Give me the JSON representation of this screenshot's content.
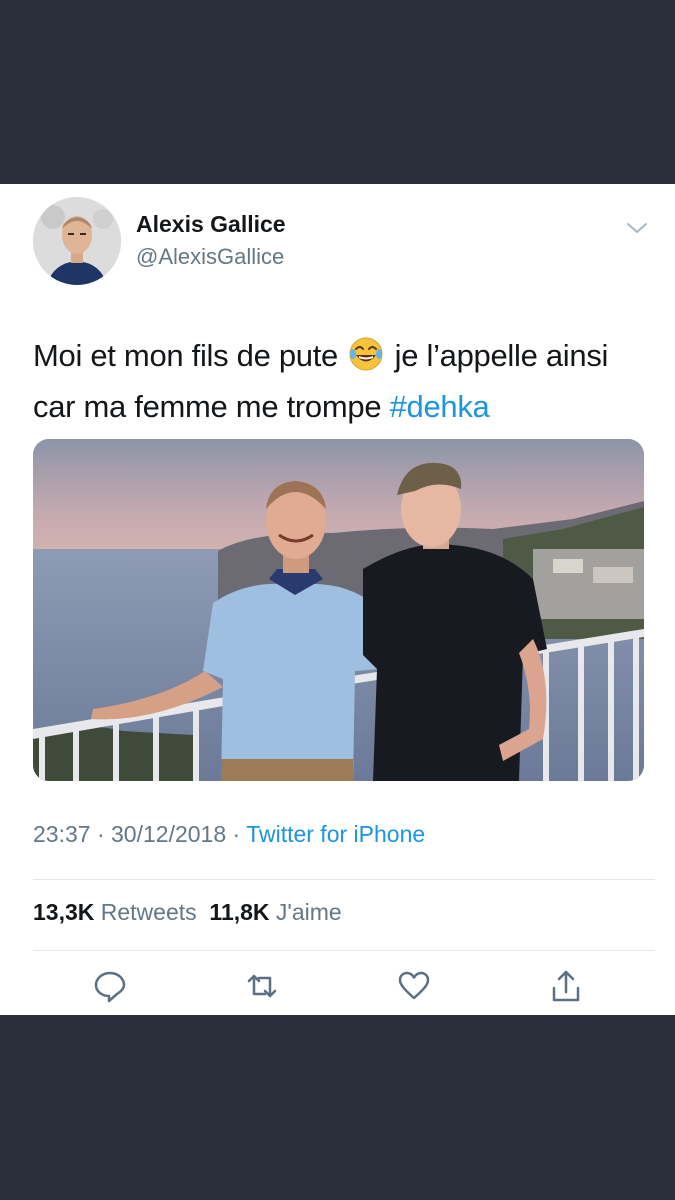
{
  "tweet": {
    "author_name": "Alexis Gallice",
    "author_handle": "@AlexisGallice",
    "text_part1": "Moi et mon fils de pute",
    "text_part2": "je l’appelle ainsi car ma femme me trompe",
    "hashtag": "#dehka",
    "emoji": "face-with-tears-of-joy",
    "photo": "two-men-on-balcony-photo",
    "time": "23:37",
    "date": "30/12/2018",
    "separator": "·",
    "source": "Twitter for iPhone"
  },
  "stats": {
    "retweets_count": "13,3K",
    "retweets_label": "Retweets",
    "likes_count": "11,8K",
    "likes_label": "J'aime"
  },
  "actions": [
    "reply-icon",
    "retweet-icon",
    "like-icon",
    "share-icon"
  ],
  "colors": {
    "background": "#2a2f3a",
    "card": "#ffffff",
    "link": "#1b95e0",
    "secondary_text": "#657786",
    "primary_text": "#14171a"
  }
}
